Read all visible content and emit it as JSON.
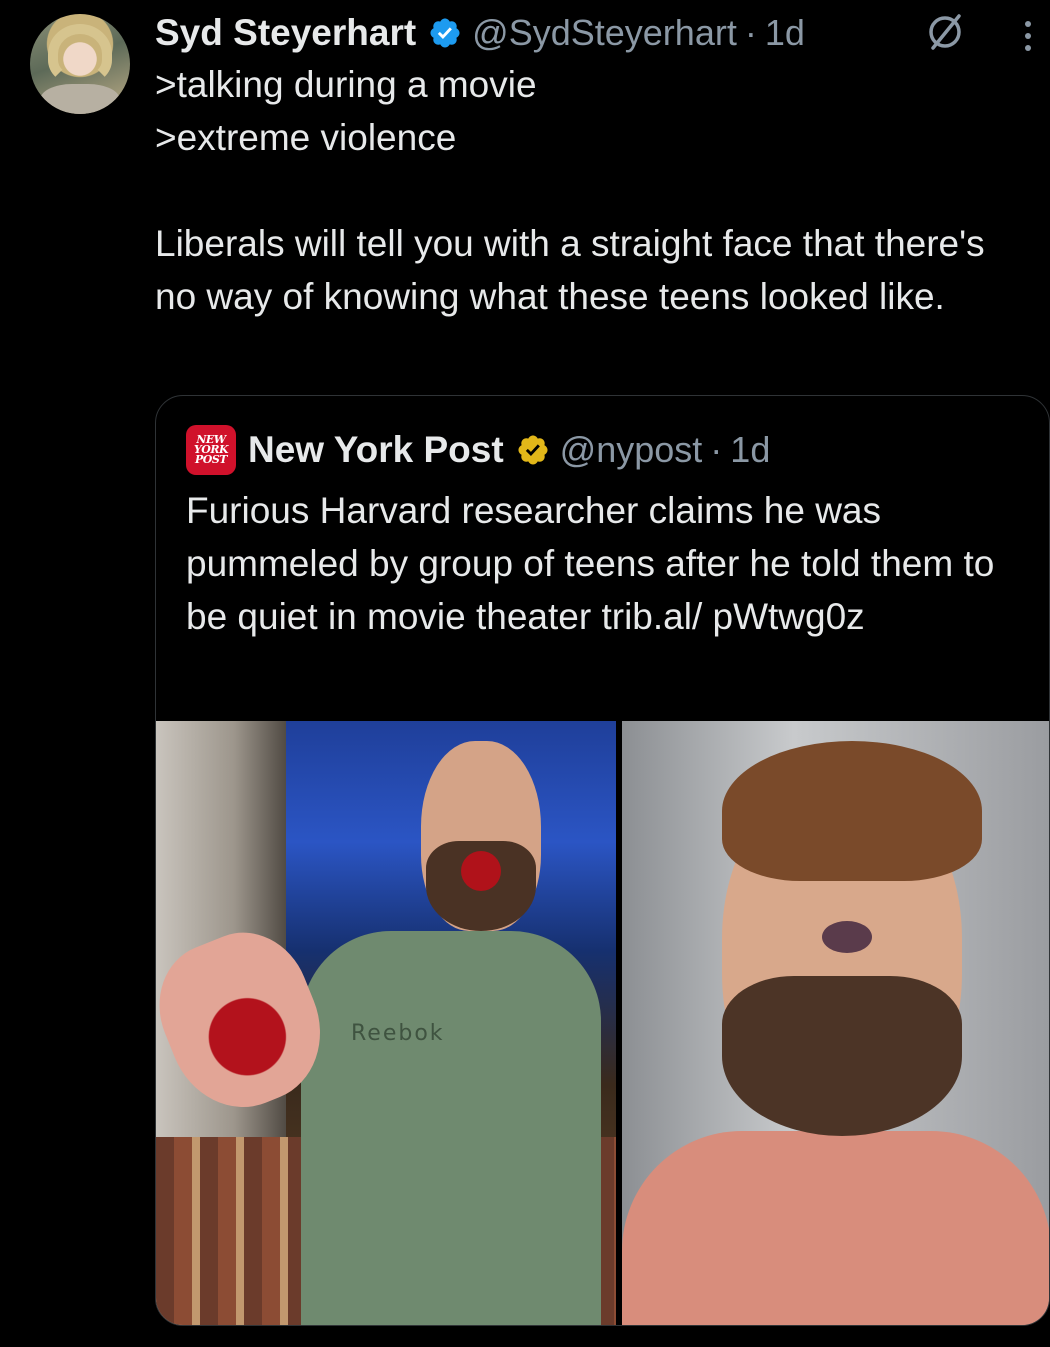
{
  "tweet": {
    "author": {
      "name": "Syd Steyerhart",
      "handle": "@SydSteyerhart",
      "verified": true,
      "avatar_icon": "user-avatar"
    },
    "separator": "·",
    "time": "1d",
    "lines": [
      ">talking during a movie",
      ">extreme violence",
      "Liberals will tell you with a straight face that there's no way of knowing what these teens looked like."
    ]
  },
  "quote": {
    "author": {
      "name": "New York Post",
      "handle": "@nypost",
      "logo_text": [
        "NEW",
        "YORK",
        "POST"
      ],
      "verified": true,
      "badge_color": "#e2b719"
    },
    "separator": "·",
    "time": "1d",
    "text": "Furious Harvard researcher claims he was pummeled by group of teens after he told them to be quiet in movie theater trib.al/ pWtwg0z",
    "media": {
      "left_shirt_text": "Reebok"
    }
  },
  "colors": {
    "background": "#000000",
    "text": "#e7e9ea",
    "secondary": "#8b98a5",
    "verified_blue": "#1d9bf0",
    "verified_gold": "#e2b719",
    "nypost_red": "#d0112b"
  },
  "icons": [
    "grok-icon",
    "more-options-icon",
    "verified-badge-icon"
  ]
}
